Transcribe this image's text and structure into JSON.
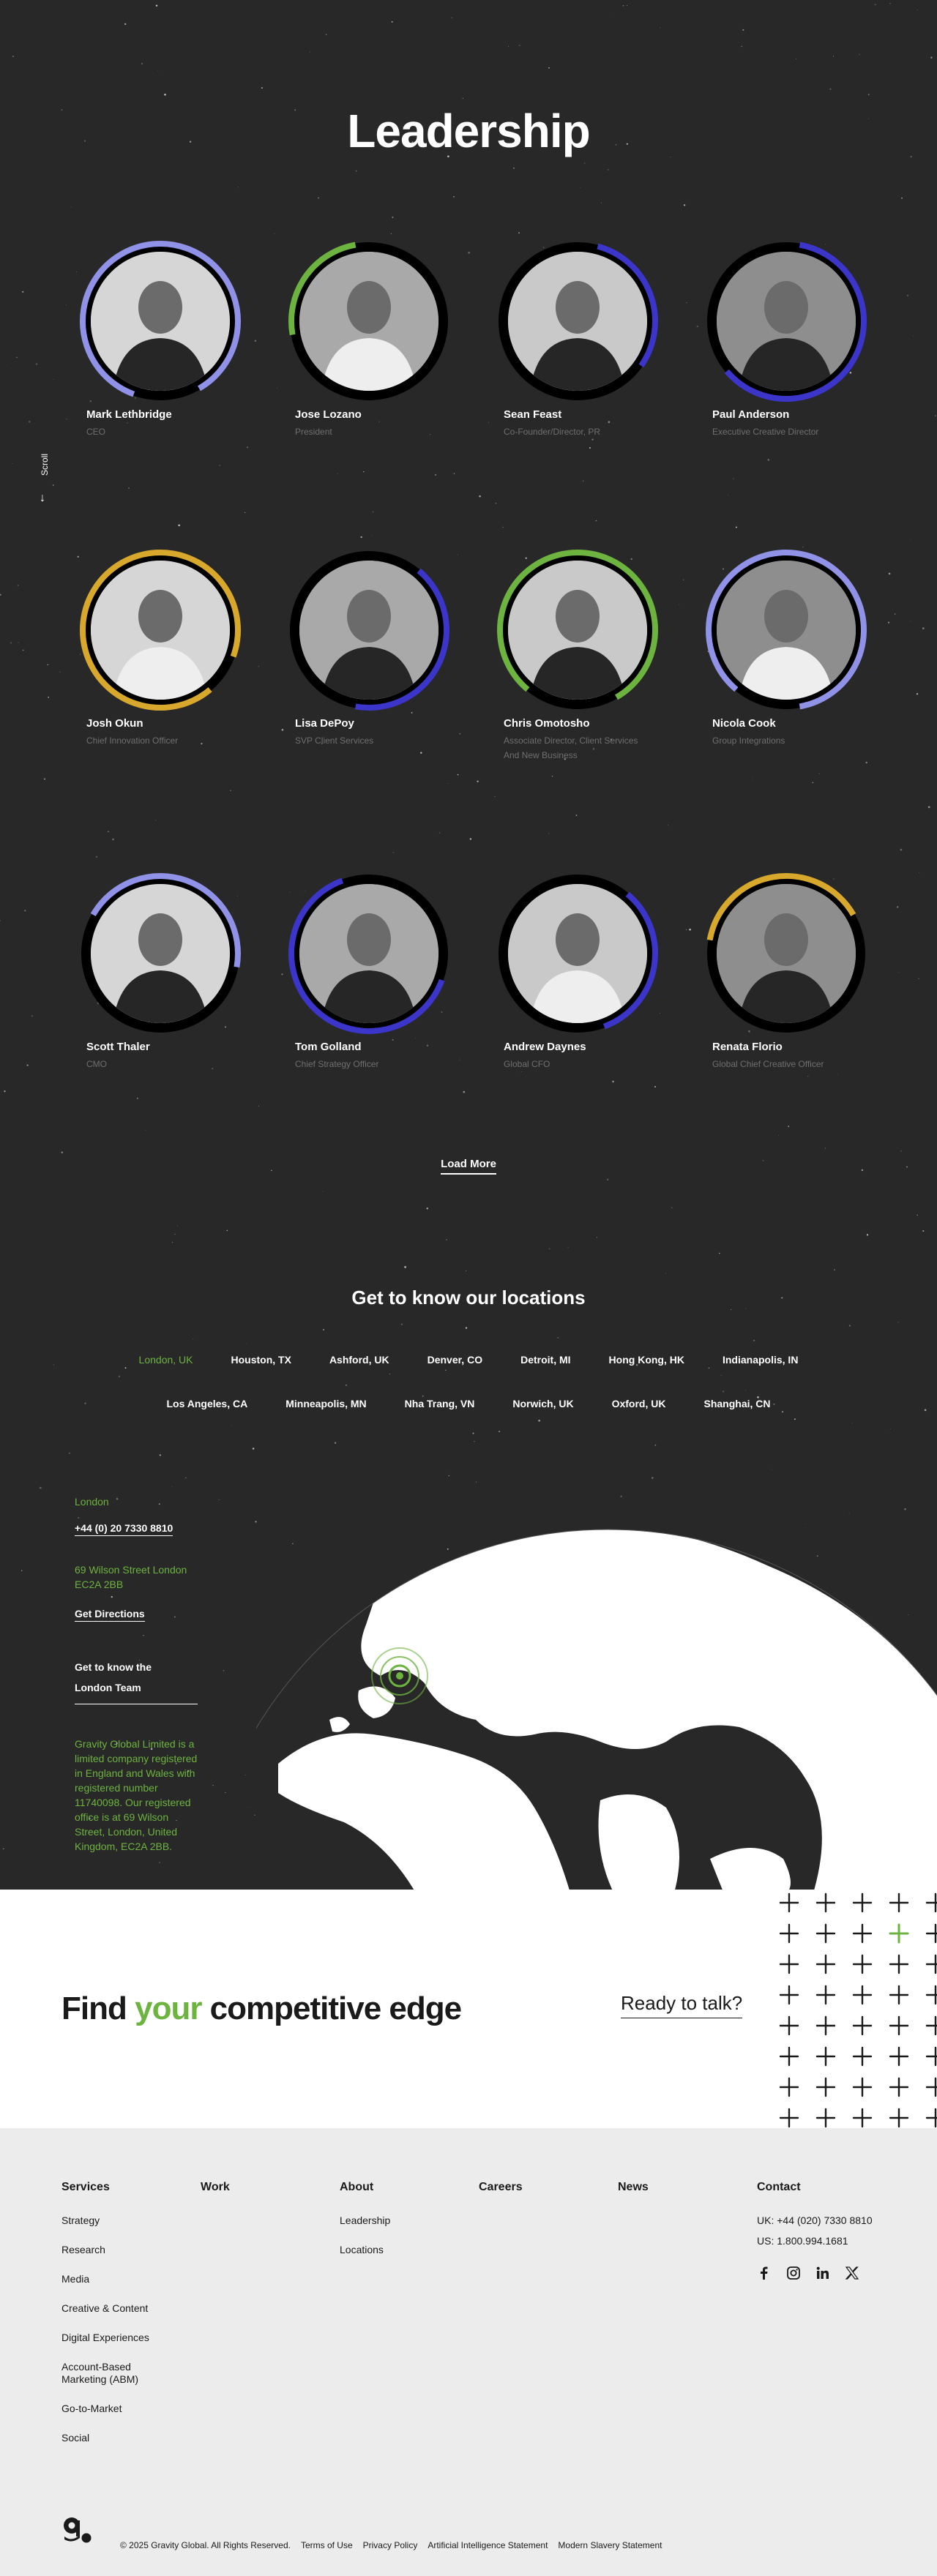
{
  "colors": {
    "green": "#6db33f",
    "blue": "#3b35c9",
    "periwinkle": "#8f92e6",
    "gold": "#d7a82c"
  },
  "section_title": "Leadership",
  "scroll_label": "Scroll",
  "people": [
    {
      "name": "Mark Lethbridge",
      "role": "CEO",
      "ring": "periwinkle"
    },
    {
      "name": "Jose Lozano",
      "role": "President",
      "ring": "green"
    },
    {
      "name": "Sean Feast",
      "role": "Co-Founder/Director, PR",
      "ring": "blue"
    },
    {
      "name": "Paul Anderson",
      "role": "Executive Creative Director",
      "ring": "blue"
    },
    {
      "name": "Josh Okun",
      "role": "Chief Innovation Officer",
      "ring": "gold"
    },
    {
      "name": "Lisa DePoy",
      "role": "SVP Client Services",
      "ring": "blue"
    },
    {
      "name": "Chris Omotosho",
      "role": "Associate Director, Client Services And New Business",
      "ring": "green"
    },
    {
      "name": "Nicola Cook",
      "role": "Group Integrations",
      "ring": "periwinkle"
    },
    {
      "name": "Scott Thaler",
      "role": "CMO",
      "ring": "periwinkle"
    },
    {
      "name": "Tom Golland",
      "role": "Chief Strategy Officer",
      "ring": "blue"
    },
    {
      "name": "Andrew Daynes",
      "role": "Global CFO",
      "ring": "blue"
    },
    {
      "name": "Renata Florio",
      "role": "Global Chief Creative Officer",
      "ring": "gold"
    }
  ],
  "load_more": "Load More",
  "locations_title": "Get to know our locations",
  "locations_row1": [
    "London, UK",
    "Houston, TX",
    "Ashford, UK",
    "Denver, CO",
    "Detroit, MI",
    "Hong Kong, HK",
    "Indianapolis, IN"
  ],
  "locations_row2": [
    "Los Angeles, CA",
    "Minneapolis, MN",
    "Nha Trang, VN",
    "Norwich, UK",
    "Oxford, UK",
    "Shanghai, CN"
  ],
  "office": {
    "city": "London",
    "phone": "+44 (0) 20 7330 8810",
    "address": "69 Wilson Street London EC2A 2BB",
    "directions": "Get Directions",
    "team_link_1": "Get to know the",
    "team_link_2": "London Team",
    "legal": "Gravity Global Limited is a limited company registered in England and Wales with registered number 11740098. Our registered office is at 69 Wilson Street, London, United Kingdom, EC2A 2BB."
  },
  "cta": {
    "headline_1": "Find ",
    "headline_2": "your",
    "headline_3": " competitive edge",
    "talk": "Ready to talk?"
  },
  "footer": {
    "services": {
      "title": "Services",
      "links": [
        "Strategy",
        "Research",
        "Media",
        "Creative & Content",
        "Digital Experiences",
        "Account-Based Marketing (ABM)",
        "Go-to-Market",
        "Social"
      ]
    },
    "work": {
      "title": "Work"
    },
    "about": {
      "title": "About",
      "links": [
        "Leadership",
        "Locations"
      ]
    },
    "careers": {
      "title": "Careers"
    },
    "news": {
      "title": "News"
    },
    "contact": {
      "title": "Contact",
      "uk": "UK: +44 (020) 7330 8810",
      "us": "US: 1.800.994.1681"
    },
    "copyright": "© 2025 Gravity Global. All Rights Reserved.",
    "legal_links": [
      "Terms of Use",
      "Privacy Policy",
      "Artificial Intelligence Statement",
      "Modern Slavery Statement"
    ]
  },
  "icons": [
    "scroll-arrow-icon",
    "facebook-icon",
    "instagram-icon",
    "linkedin-icon",
    "x-icon",
    "gravity-logo-icon"
  ]
}
